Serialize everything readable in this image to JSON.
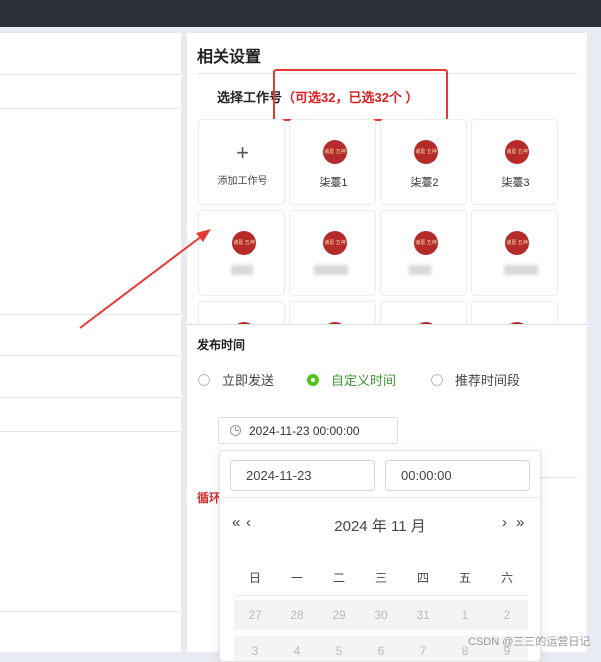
{
  "settings": {
    "title": "相关设置",
    "select_label_prefix": "选择工作号",
    "select_label_count": "（可选32，已选32个 ）",
    "add_label": "添加工作号",
    "accounts": [
      {
        "name": "柒薹1"
      },
      {
        "name": "柒薹2"
      },
      {
        "name": "柒薹3"
      }
    ],
    "avatar_text": "诸葛 五神"
  },
  "publish": {
    "label": "发布时间",
    "options": [
      {
        "label": "立即发送",
        "checked": false
      },
      {
        "label": "自定义时间",
        "checked": true
      },
      {
        "label": "推荐时间段",
        "checked": false
      }
    ],
    "datetime_value": "2024-11-23 00:00:00"
  },
  "cycle_label": "循环",
  "picker": {
    "date_value": "2024-11-23",
    "time_value": "00:00:00",
    "prev_year": "«",
    "prev_month": "‹",
    "next_month": "›",
    "next_year": "»",
    "month_title": "2024 年  11 月",
    "weekdays": [
      "日",
      "一",
      "二",
      "三",
      "四",
      "五",
      "六"
    ],
    "weeks": [
      [
        "27",
        "28",
        "29",
        "30",
        "31",
        "1",
        "2"
      ],
      [
        "3",
        "4",
        "5",
        "6",
        "7",
        "8",
        "9"
      ]
    ]
  },
  "colors": {
    "accent_green": "#52c41a",
    "annotation_red": "#e53935",
    "avatar_red": "#b52a2a"
  },
  "watermark": "CSDN @三三的运营日记"
}
